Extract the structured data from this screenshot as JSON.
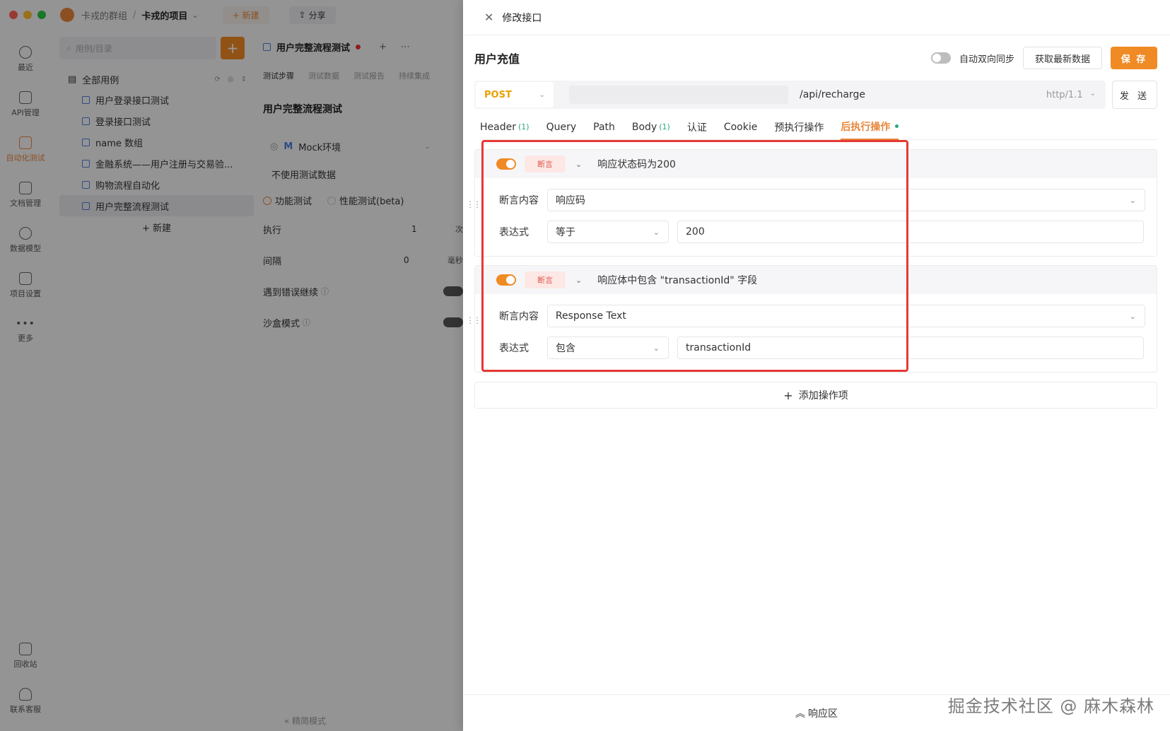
{
  "titlebar": {
    "workspace": "卡戎的群组",
    "separator": "/",
    "project": "卡戎的项目",
    "new_label": "+ 新建",
    "share_label": "分享",
    "traffic_colors": [
      "#ff5f57",
      "#febc2e",
      "#28c840"
    ]
  },
  "leftnav": {
    "items": [
      {
        "label": "最近",
        "icon": "clock-icon"
      },
      {
        "label": "API管理",
        "icon": "api-icon"
      },
      {
        "label": "自动化测试",
        "icon": "automation-icon"
      },
      {
        "label": "文档管理",
        "icon": "document-icon"
      },
      {
        "label": "数据模型",
        "icon": "data-model-icon"
      },
      {
        "label": "项目设置",
        "icon": "settings-icon"
      },
      {
        "label": "更多",
        "icon": "more-icon"
      }
    ],
    "bottom": [
      {
        "label": "回收站",
        "icon": "trash-icon"
      },
      {
        "label": "联系客服",
        "icon": "headset-icon"
      }
    ]
  },
  "tree": {
    "search_placeholder": "用例/目录",
    "root": "全部用例",
    "items": [
      "用户登录接口测试",
      "登录接口测试",
      "name 数组",
      "金融系统——用户注册与交易验...",
      "购物流程自动化",
      "用户完整流程测试"
    ],
    "add_label": "+ 新建"
  },
  "middle": {
    "tab_title": "用户完整流程测试",
    "sub_tabs": [
      "测试步骤",
      "测试数据",
      "测试报告",
      "持续集成"
    ],
    "title": "用户完整流程测试",
    "env_m": "M",
    "env": "Mock环境",
    "test_data": "不使用测试数据",
    "radio_functional": "功能测试",
    "radio_perf": "性能测试(beta)",
    "exec_label": "执行",
    "exec_value": "1",
    "exec_unit": "次",
    "interval_label": "间隔",
    "interval_value": "0",
    "interval_unit": "毫秒",
    "continue_label": "遇到错误继续",
    "sandbox_label": "沙盒模式",
    "compact_label": "« 精简模式"
  },
  "drawer": {
    "title": "修改接口",
    "api_name": "用户充值",
    "sync_label": "自动双向同步",
    "fetch_label": "获取最新数据",
    "save_label": "保 存",
    "method": "POST",
    "path": "/api/recharge",
    "protocol": "http/1.1",
    "send_label": "发 送",
    "tabs": [
      {
        "label": "Header",
        "count": "(1)"
      },
      {
        "label": "Query",
        "count": ""
      },
      {
        "label": "Path",
        "count": ""
      },
      {
        "label": "Body",
        "count": "(1)"
      },
      {
        "label": "认证",
        "count": ""
      },
      {
        "label": "Cookie",
        "count": ""
      },
      {
        "label": "预执行操作",
        "count": ""
      },
      {
        "label": "后执行操作",
        "count": ""
      }
    ],
    "ops": [
      {
        "tag": "断言",
        "title": "响应状态码为200",
        "content_label": "断言内容",
        "content": "响应码",
        "expr_label": "表达式",
        "operator": "等于",
        "value": "200"
      },
      {
        "tag": "断言",
        "title": "响应体中包含 \"transactionId\" 字段",
        "content_label": "断言内容",
        "content": "Response Text",
        "expr_label": "表达式",
        "operator": "包含",
        "value": "transactionId"
      }
    ],
    "add_op_label": "添加操作项",
    "response_label": "响应区"
  },
  "watermark": "掘金技术社区 @ 麻木森林",
  "colors": {
    "accent": "#f08a24",
    "highlight": "#e53935",
    "method": "#e8a200",
    "count": "#2aa77a"
  }
}
